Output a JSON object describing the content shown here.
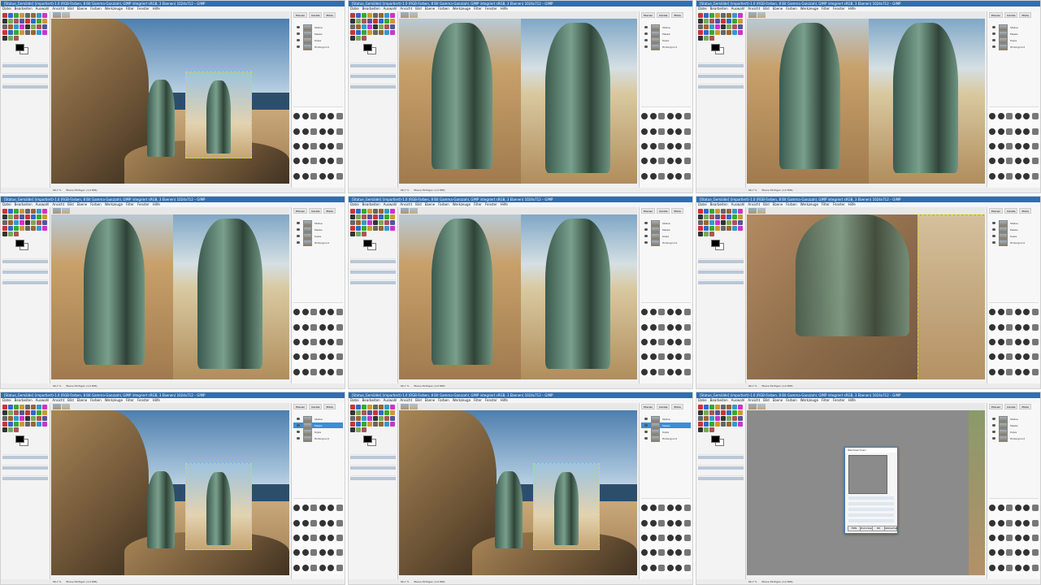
{
  "window": {
    "title": "[Statue_Gemälde] (importiert)-1.0 (RGB-Farben, 8 Bit Gamma-Ganzzahl, GIMP integriert sRGB, 3 Ebenen) 1024x712 – GIMP"
  },
  "menu": [
    "Datei",
    "Bearbeiten",
    "Auswahl",
    "Ansicht",
    "Bild",
    "Ebene",
    "Farben",
    "Werkzeuge",
    "Filter",
    "Fenster",
    "Hilfe"
  ],
  "dock": {
    "tabs": [
      "Ebenen",
      "Kanäle",
      "Pfade"
    ],
    "layers": [
      "Statue",
      "Maske",
      "Kopie",
      "Hintergrund"
    ]
  },
  "status": {
    "zoom": "66,7 %",
    "message": "Ebene Einfügen (1,9 MiB)"
  },
  "dialog": {
    "title": "Weichzeichnen",
    "rows": [
      "Gaußscher",
      "Radius",
      "Abtastung",
      "Kanten",
      "Glanz"
    ],
    "buttons": [
      "Hilfe",
      "Zurücksetzen",
      "OK",
      "Abbrechen"
    ]
  },
  "colors": {
    "titlebar": "#2c6fb4",
    "selection": "#3b8ed8"
  }
}
